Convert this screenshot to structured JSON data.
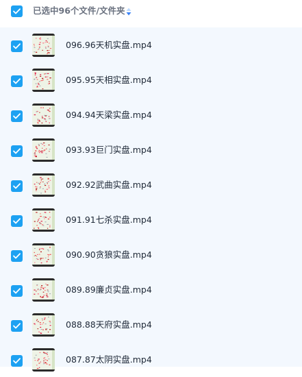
{
  "header": {
    "title": "已选中96个文件/文件夹",
    "checked": true
  },
  "colors": {
    "accent": "#1da1f2",
    "list_background": "#f3f8fe",
    "text": "#1f2937",
    "header_text": "#6b7280"
  },
  "files": [
    {
      "name": "096.96天机实盘.mp4",
      "checked": true
    },
    {
      "name": "095.95天相实盘.mp4",
      "checked": true
    },
    {
      "name": "094.94天梁实盘.mp4",
      "checked": true
    },
    {
      "name": "093.93巨门实盘.mp4",
      "checked": true
    },
    {
      "name": "092.92武曲实盘.mp4",
      "checked": true
    },
    {
      "name": "091.91七杀实盘.mp4",
      "checked": true
    },
    {
      "name": "090.90贪狼实盘.mp4",
      "checked": true
    },
    {
      "name": "089.89廉贞实盘.mp4",
      "checked": true
    },
    {
      "name": "088.88天府实盘.mp4",
      "checked": true
    },
    {
      "name": "087.87太阴实盘.mp4",
      "checked": true
    }
  ]
}
